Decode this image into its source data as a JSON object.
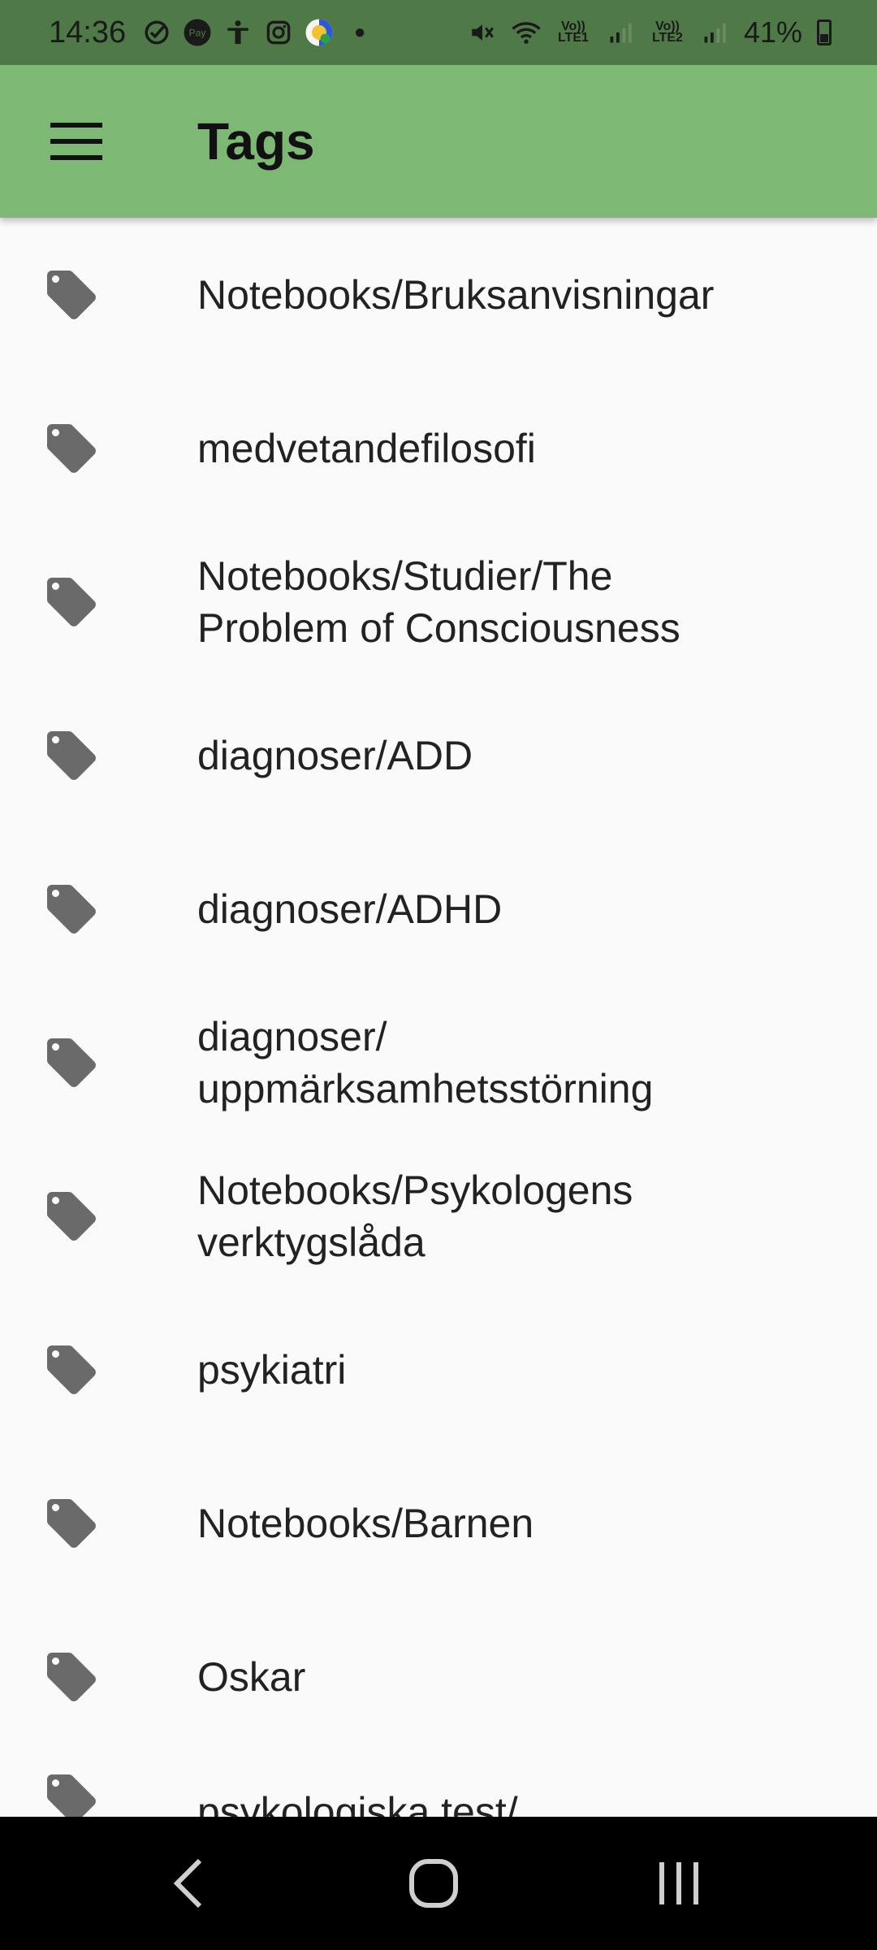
{
  "status_bar": {
    "time": "14:36",
    "left_icons": [
      "check-circle-icon",
      "pay-icon",
      "accessibility-icon",
      "instagram-icon",
      "app-badge-icon",
      "dot-icon"
    ],
    "volte1": "Vo)) LTE1",
    "volte2": "Vo)) LTE2",
    "battery": "41%"
  },
  "app_bar": {
    "title": "Tags",
    "menu_icon": "hamburger-menu-icon",
    "background": "#7db874"
  },
  "tags": [
    {
      "label": "Notebooks/Bruksanvisningar"
    },
    {
      "label": "medvetandefilosofi"
    },
    {
      "label": "Notebooks/Studier/The Problem of Consciousness"
    },
    {
      "label": "diagnoser/ADD"
    },
    {
      "label": "diagnoser/ADHD"
    },
    {
      "label": "diagnoser/ uppmärksamhetsstörning"
    },
    {
      "label": "Notebooks/Psykologens verktygslåda"
    },
    {
      "label": "psykiatri"
    },
    {
      "label": "Notebooks/Barnen"
    },
    {
      "label": "Oskar"
    },
    {
      "label": "psykologiska test/"
    }
  ],
  "tag_icon": "tag-icon",
  "nav_bar": {
    "back": "back-icon",
    "home": "home-icon",
    "recents": "recents-icon"
  }
}
